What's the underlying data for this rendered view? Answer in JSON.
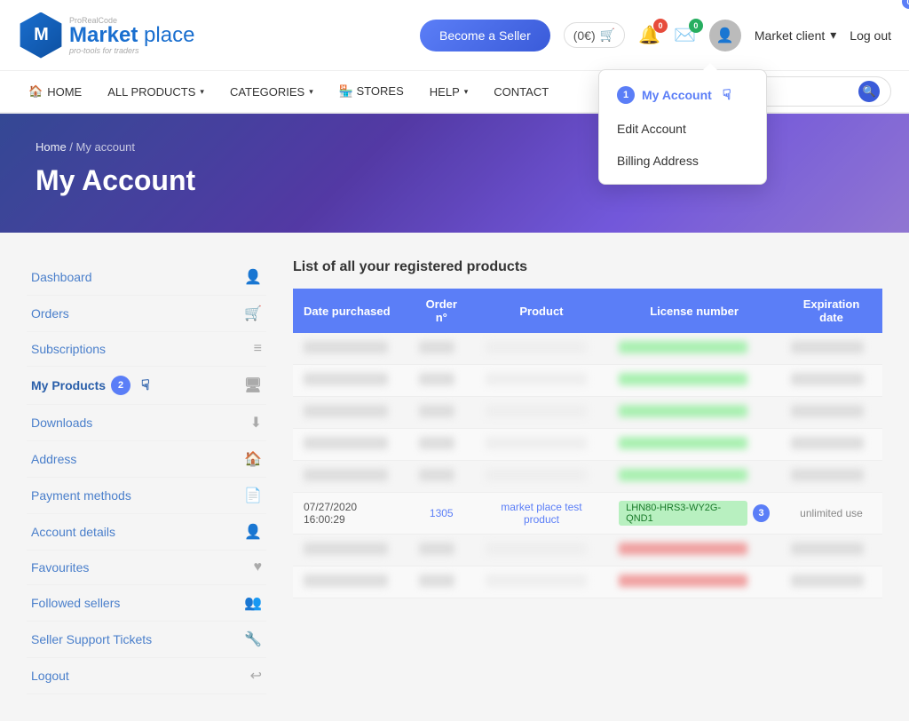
{
  "header": {
    "logo_letter": "M",
    "logo_brand_top": "ProRealCode",
    "logo_main_first": "Market",
    "logo_main_second": "place",
    "logo_tagline": "pro-tools for traders",
    "become_seller_label": "Become a Seller",
    "cart_label": "(0€)",
    "cart_badge": "0",
    "bell_badge": "0",
    "mail_badge": "0",
    "user_menu_label": "Market client",
    "logout_label": "Log out"
  },
  "nav": {
    "items": [
      {
        "id": "home",
        "label": "HOME",
        "icon": "🏠",
        "has_arrow": false
      },
      {
        "id": "all-products",
        "label": "ALL PRODUCTS",
        "has_arrow": true
      },
      {
        "id": "categories",
        "label": "CATEGORIES",
        "has_arrow": true
      },
      {
        "id": "stores",
        "label": "🏪 STORES",
        "has_arrow": false
      },
      {
        "id": "help",
        "label": "HELP",
        "has_arrow": true
      },
      {
        "id": "contact",
        "label": "CONTACT",
        "has_arrow": false
      }
    ],
    "search_placeholder": "Search"
  },
  "hero": {
    "breadcrumb_home": "Home",
    "breadcrumb_separator": "/",
    "breadcrumb_current": "My account",
    "title": "My Account"
  },
  "dropdown": {
    "badge": "1",
    "items": [
      {
        "id": "my-account",
        "label": "My Account",
        "active": true
      },
      {
        "id": "edit-account",
        "label": "Edit Account",
        "active": false
      },
      {
        "id": "billing-address",
        "label": "Billing Address",
        "active": false
      }
    ]
  },
  "sidebar": {
    "items": [
      {
        "id": "dashboard",
        "label": "Dashboard",
        "icon": "👤"
      },
      {
        "id": "orders",
        "label": "Orders",
        "icon": "🛒"
      },
      {
        "id": "subscriptions",
        "label": "Subscriptions",
        "icon": "≡"
      },
      {
        "id": "my-products",
        "label": "My Products",
        "icon": "🖥",
        "badge": "2"
      },
      {
        "id": "downloads",
        "label": "Downloads",
        "icon": "⬇"
      },
      {
        "id": "address",
        "label": "Address",
        "icon": "🏠"
      },
      {
        "id": "payment-methods",
        "label": "Payment methods",
        "icon": "📄"
      },
      {
        "id": "account-details",
        "label": "Account details",
        "icon": "👤"
      },
      {
        "id": "favourites",
        "label": "Favourites",
        "icon": "♥"
      },
      {
        "id": "followed-sellers",
        "label": "Followed sellers",
        "icon": "👥"
      },
      {
        "id": "seller-support",
        "label": "Seller Support Tickets",
        "icon": "🔧"
      },
      {
        "id": "logout",
        "label": "Logout",
        "icon": "↩"
      }
    ]
  },
  "table": {
    "title": "List of all your registered products",
    "columns": [
      "Date purchased",
      "Order n°",
      "Product",
      "License number",
      "Expiration date"
    ],
    "rows": [
      {
        "date": "",
        "order": "",
        "product": "",
        "license": "",
        "expiry": "",
        "blurred": true,
        "license_style": "green"
      },
      {
        "date": "",
        "order": "",
        "product": "",
        "license": "",
        "expiry": "",
        "blurred": true,
        "license_style": "green"
      },
      {
        "date": "",
        "order": "",
        "product": "",
        "license": "",
        "expiry": "",
        "blurred": true,
        "license_style": "green"
      },
      {
        "date": "",
        "order": "",
        "product": "",
        "license": "",
        "expiry": "",
        "blurred": true,
        "license_style": "green"
      },
      {
        "date": "",
        "order": "",
        "product": "",
        "license": "",
        "expiry": "",
        "blurred": true,
        "license_style": "green"
      },
      {
        "date": "07/27/2020 16:00:29",
        "order": "1305",
        "product": "market place test product",
        "license": "LHN80-HRS3-WY2G-QND1",
        "expiry": "unlimited use",
        "blurred": false,
        "badge": "3"
      },
      {
        "date": "",
        "order": "",
        "product": "",
        "license": "",
        "expiry": "",
        "blurred": true,
        "license_style": "red"
      },
      {
        "date": "",
        "order": "",
        "product": "",
        "license": "",
        "expiry": "",
        "blurred": true,
        "license_style": "red"
      }
    ]
  }
}
